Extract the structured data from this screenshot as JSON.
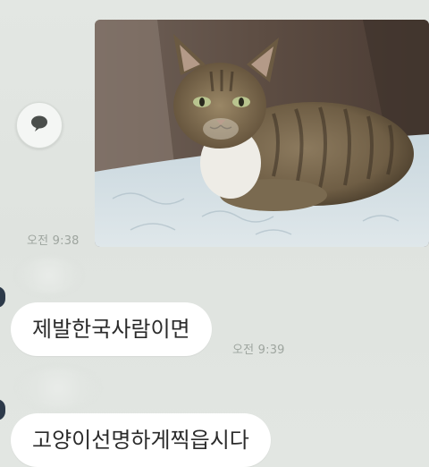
{
  "messages": [
    {
      "type": "image",
      "image_subject": "tabby cat lying on a white quilted blanket",
      "time": "오전 9:38"
    },
    {
      "type": "text",
      "text": "제발한국사람이면",
      "time": "오전 9:39"
    },
    {
      "type": "text",
      "text": "고양이선명하게찍읍시다"
    }
  ],
  "icons": {
    "share": "speech-bubble-icon"
  },
  "colors": {
    "background": "#dfe4e0",
    "bubble": "#ffffff",
    "timestamp": "#9ea59f"
  }
}
